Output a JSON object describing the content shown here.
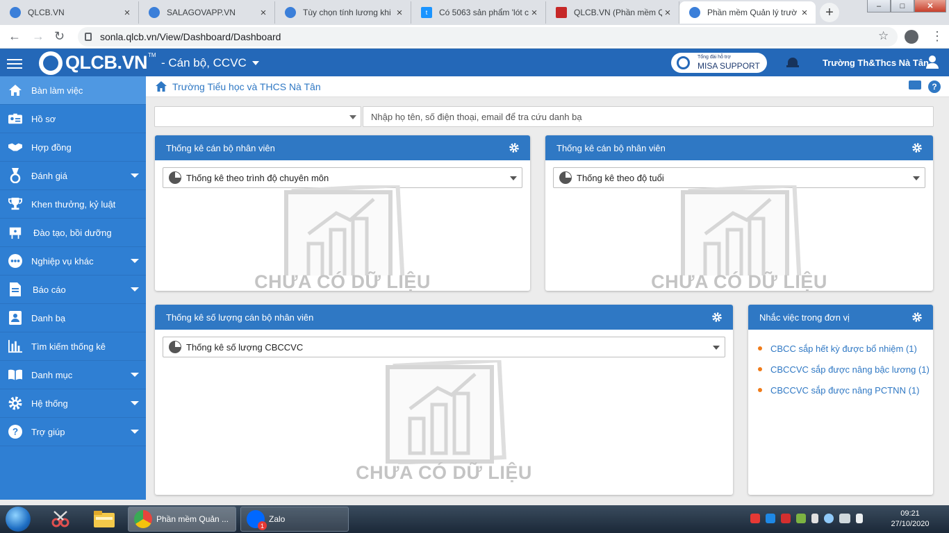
{
  "browser": {
    "tabs": [
      {
        "title": "QLCB.VN",
        "icon_color": "#3b7fd9"
      },
      {
        "title": "SALAGOVAPP.VN",
        "icon_color": "#3b7fd9"
      },
      {
        "title": "Tùy chọn tính lương khi",
        "icon_color": "#3b7fd9"
      },
      {
        "title": "Có 5063 sản phẩm 'lót c",
        "icon_color": "#1a94ff"
      },
      {
        "title": "QLCB.VN (Phần mềm Qu",
        "icon_color": "#c62828"
      },
      {
        "title": "Phần mềm Quản lý trườ",
        "icon_color": "#3b7fd9"
      }
    ],
    "url": "sonla.qlcb.vn/View/Dashboard/Dashboard"
  },
  "app": {
    "logo": "QLCB.VN",
    "logo_tm": "TM",
    "module": "- Cán bộ, CCVC",
    "support_small": "Tổng đài hỗ trợ",
    "support": "MISA SUPPORT",
    "user": "Trường Th&Thcs Nà Tân",
    "accent": "#2468b8"
  },
  "sidebar": {
    "items": [
      {
        "label": "Bàn làm việc",
        "icon": "home-icon",
        "active": true
      },
      {
        "label": "Hồ sơ",
        "icon": "id-card-icon"
      },
      {
        "label": "Hợp đồng",
        "icon": "handshake-icon"
      },
      {
        "label": "Đánh giá",
        "icon": "medal-icon",
        "expand": true
      },
      {
        "label": "Khen thưởng, kỷ luật",
        "icon": "trophy-icon"
      },
      {
        "label": "Đào tạo, bồi dưỡng",
        "icon": "training-icon"
      },
      {
        "label": "Nghiệp vụ khác",
        "icon": "more-icon",
        "expand": true
      },
      {
        "label": "Báo cáo",
        "icon": "report-icon",
        "expand": true
      },
      {
        "label": "Danh bạ",
        "icon": "contacts-icon"
      },
      {
        "label": "Tìm kiếm thống kê",
        "icon": "bar-chart-icon"
      },
      {
        "label": "Danh mục",
        "icon": "book-icon",
        "expand": true
      },
      {
        "label": "Hệ thống",
        "icon": "gear-icon",
        "expand": true
      },
      {
        "label": "Trợ giúp",
        "icon": "help-icon",
        "expand": true
      }
    ]
  },
  "breadcrumb": "Trường Tiểu học và THCS Nà Tân",
  "search": {
    "unit_value": "",
    "placeholder": "Nhập họ tên, số điện thoại, email để tra cứu danh bạ"
  },
  "panels": {
    "p1": {
      "title": "Thống kê cán bộ nhân viên",
      "select": "Thống kê theo trình độ chuyên môn",
      "empty": "CHƯA CÓ DỮ LIỆU"
    },
    "p2": {
      "title": "Thống kê cán bộ nhân viên",
      "select": "Thống kê theo độ tuổi",
      "empty": "CHƯA CÓ DỮ LIỆU"
    },
    "p3": {
      "title": "Thống kê số lượng cán bộ nhân viên",
      "select": "Thống kê số lượng CBCCVC",
      "empty": "CHƯA CÓ DỮ LIỆU"
    },
    "reminders": {
      "title": "Nhắc việc trong đơn vị",
      "items": [
        "CBCC sắp hết kỳ được bổ nhiệm (1)",
        "CBCCVC sắp được nâng bậc lương (1)",
        "CBCCVC sắp được nâng PCTNN (1)"
      ]
    }
  },
  "taskbar": {
    "apps": [
      {
        "label": "Phần mềm Quản ...",
        "icon_color": "#e8453c"
      },
      {
        "label": "Zalo",
        "icon_color": "#0068ff",
        "badge": "1"
      }
    ],
    "time": "09:21",
    "date": "27/10/2020"
  }
}
